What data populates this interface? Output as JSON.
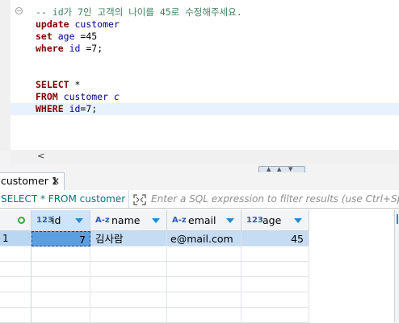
{
  "editor": {
    "comment_line": "-- id가 7인 고객의 나이를 45로 수정해주세요.",
    "update": {
      "kw_update": "update",
      "table": "customer"
    },
    "set": {
      "kw_set": "set",
      "column": "age",
      "op": " =",
      "value": "45"
    },
    "where1": {
      "kw_where": "where",
      "column": "id",
      "op": " =",
      "value": "7",
      "end": ";"
    },
    "select": {
      "kw_select": "SELECT",
      "star": " *"
    },
    "from": {
      "kw_from": "FROM",
      "table": "customer",
      "alias": "c"
    },
    "where2": {
      "kw_where": "WHERE",
      "column": "id",
      "op": "=",
      "value": "7",
      "end": ";"
    },
    "hscroll_left": "<"
  },
  "results": {
    "tab_label": "customer 1",
    "tab_close": "✕",
    "query_preview": "SELECT * FROM customer c W",
    "filter_placeholder": "Enter a SQL expression to filter results (use Ctrl+Space)",
    "columns": [
      {
        "type": "123",
        "name": "id"
      },
      {
        "type": "A-z",
        "name": "name"
      },
      {
        "type": "A-z",
        "name": "email"
      },
      {
        "type": "123",
        "name": "age"
      }
    ],
    "rows": [
      {
        "rownum": "1",
        "id": "7",
        "name": "김사람",
        "email": "e@mail.com",
        "age": "45"
      }
    ]
  },
  "colors": {
    "keyword": "#800000",
    "identifier": "#00008b",
    "selection": "#c5dcf3",
    "focus_cell": "#5b9fe0",
    "sort_arrow": "#1d8ad6"
  }
}
